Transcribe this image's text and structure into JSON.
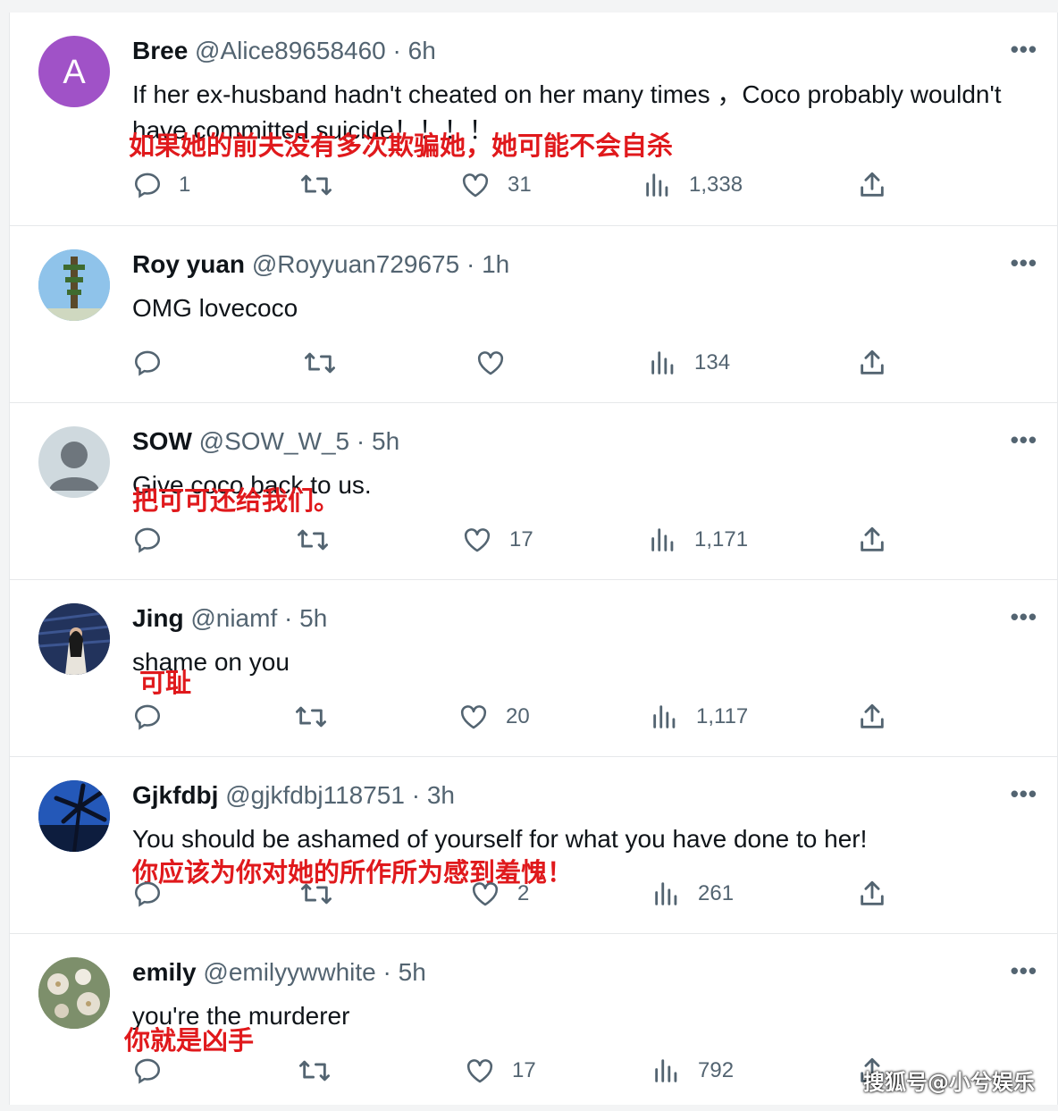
{
  "tweets": [
    {
      "name": "Bree",
      "handle": "@Alice89658460",
      "time": "6h",
      "text": "If her ex-husband hadn't cheated on her many times ，Coco probably wouldn't have committed suicide！！！！",
      "translation": "如果她的前夫没有多次欺骗她，她可能不会自杀",
      "replies": "1",
      "retweets": "",
      "likes": "31",
      "views": "1,338",
      "avatar_letter": "A",
      "avatar_color": "#a052c7"
    },
    {
      "name": "Roy yuan",
      "handle": "@Royyuan729675",
      "time": "1h",
      "text": "OMG  lovecoco",
      "translation": "",
      "replies": "",
      "retweets": "",
      "likes": "",
      "views": "134"
    },
    {
      "name": "SOW",
      "handle": "@SOW_W_5",
      "time": "5h",
      "text": "Give coco back to us.",
      "translation": "把可可还给我们。",
      "replies": "",
      "retweets": "",
      "likes": "17",
      "views": "1,171"
    },
    {
      "name": "Jing",
      "handle": "@niamf",
      "time": "5h",
      "text": "shame on you",
      "translation": "可耻",
      "replies": "",
      "retweets": "",
      "likes": "20",
      "views": "1,117"
    },
    {
      "name": "Gjkfdbj",
      "handle": "@gjkfdbj118751",
      "time": "3h",
      "text": "You should be ashamed of yourself for what you have done to her!",
      "translation": "你应该为你对她的所作所为感到羞愧！",
      "replies": "",
      "retweets": "",
      "likes": "2",
      "views": "261"
    },
    {
      "name": "emily",
      "handle": "@emilyywwhite",
      "time": "5h",
      "text": "you're the murderer",
      "translation": "你就是凶手",
      "replies": "",
      "retweets": "",
      "likes": "17",
      "views": "792"
    }
  ],
  "more_label": "•••",
  "dot": "·",
  "watermark": "搜狐号@小兮娱乐",
  "colors": {
    "text": "#0f1419",
    "secondary": "#536471",
    "translation": "#e0191c",
    "divider": "#e6e8ea"
  }
}
